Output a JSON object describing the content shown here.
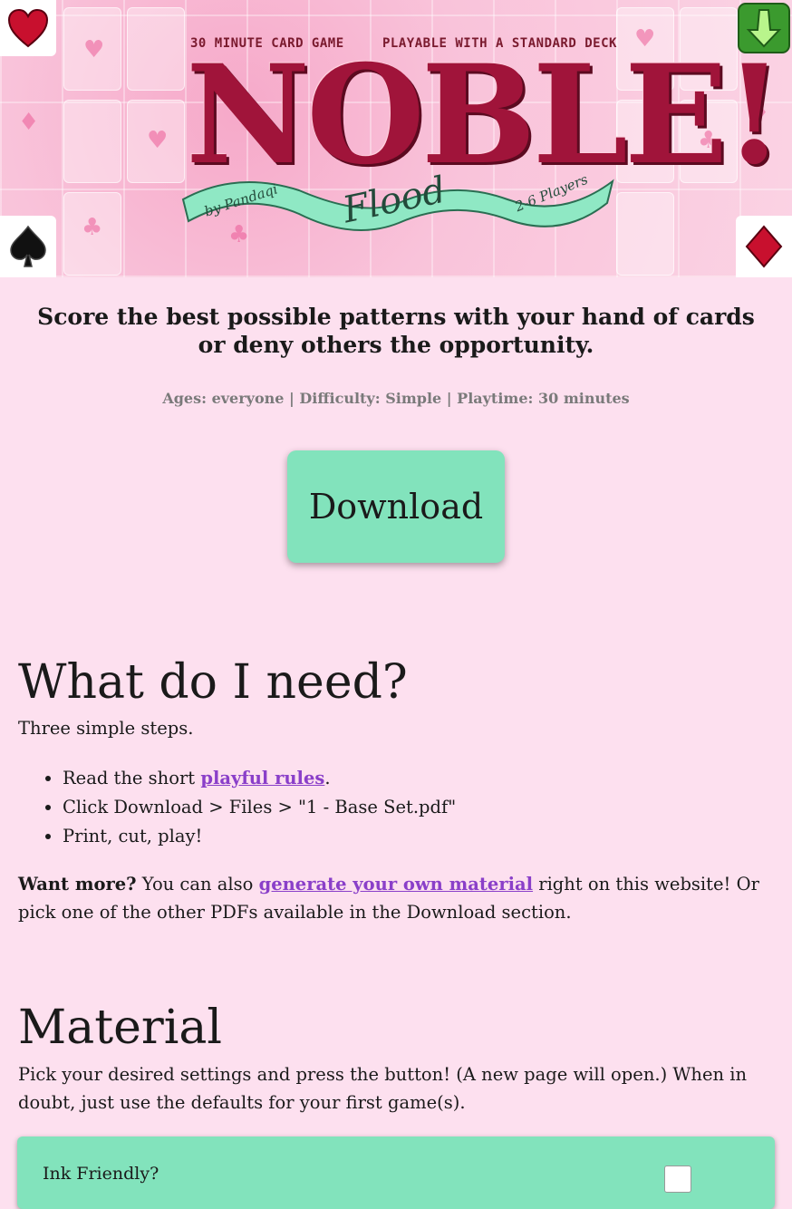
{
  "banner": {
    "tagline_left": "30 MINUTE CARD GAME",
    "tagline_right": "PLAYABLE WITH A STANDARD DECK",
    "logo_title": "NOBLE",
    "logo_exclaim": "!",
    "ribbon_author": "by Pandaqi",
    "ribbon_subtitle": "Flood",
    "ribbon_players": "2-6 Players",
    "corner_icons": [
      "heart-icon",
      "download-arrow-icon",
      "spade-icon",
      "diamond-icon"
    ]
  },
  "intro": {
    "subtitle_line1": "Score the best possible patterns with your hand of cards",
    "subtitle_line2": "or deny others the opportunity.",
    "meta": "Ages: everyone | Difficulty: Simple | Playtime: 30 minutes",
    "download_label": "Download"
  },
  "need": {
    "heading": "What do I need?",
    "lead": "Three simple steps.",
    "step1_prefix": "Read the short ",
    "step1_link": "playful rules",
    "step1_suffix": ".",
    "step2": "Click Download > Files > \"1 - Base Set.pdf\"",
    "step3": "Print, cut, play!",
    "more_bold": "Want more?",
    "more_text1": " You can also ",
    "more_link": "generate your own material",
    "more_text2": " right on this website! Or pick one of the other PDFs available in the Download section."
  },
  "material": {
    "heading": "Material",
    "lead": "Pick your desired settings and press the button! (A new page will open.) When in doubt, just use the defaults for your first game(s).",
    "first_setting_label": "Ink Friendly?"
  },
  "colors": {
    "background": "#fde0ef",
    "accent": "#82e3bc",
    "link": "#8a3fc9",
    "logo_red": "#a0143a"
  }
}
